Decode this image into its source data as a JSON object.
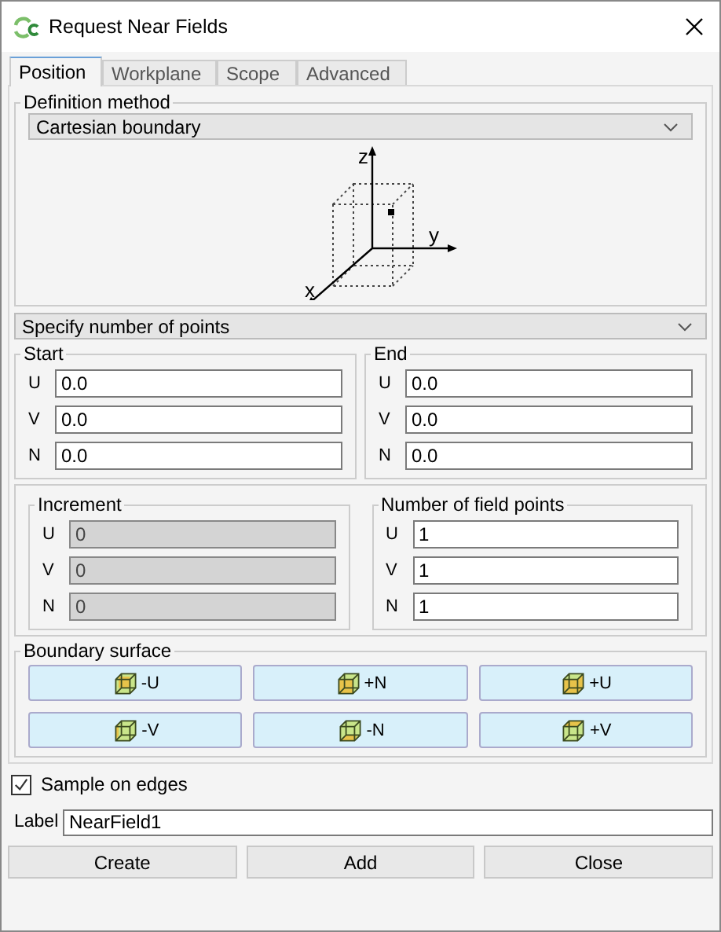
{
  "window": {
    "title": "Request Near Fields"
  },
  "tabs": [
    {
      "label": "Position",
      "selected": true
    },
    {
      "label": "Workplane",
      "selected": false
    },
    {
      "label": "Scope",
      "selected": false
    },
    {
      "label": "Advanced",
      "selected": false
    }
  ],
  "definition_method": {
    "label": "Definition method",
    "value": "Cartesian boundary"
  },
  "diagram_axes": [
    "z",
    "y",
    "x"
  ],
  "points_mode": {
    "value": "Specify number of points"
  },
  "start": {
    "label": "Start",
    "fields": [
      {
        "axis": "U",
        "value": "0.0",
        "disabled": false
      },
      {
        "axis": "V",
        "value": "0.0",
        "disabled": false
      },
      {
        "axis": "N",
        "value": "0.0",
        "disabled": false
      }
    ]
  },
  "end": {
    "label": "End",
    "fields": [
      {
        "axis": "U",
        "value": "0.0",
        "disabled": false
      },
      {
        "axis": "V",
        "value": "0.0",
        "disabled": false
      },
      {
        "axis": "N",
        "value": "0.0",
        "disabled": false
      }
    ]
  },
  "increment": {
    "label": "Increment",
    "fields": [
      {
        "axis": "U",
        "value": "0",
        "disabled": true
      },
      {
        "axis": "V",
        "value": "0",
        "disabled": true
      },
      {
        "axis": "N",
        "value": "0",
        "disabled": true
      }
    ]
  },
  "field_points": {
    "label": "Number of field points",
    "fields": [
      {
        "axis": "U",
        "value": "1",
        "disabled": false
      },
      {
        "axis": "V",
        "value": "1",
        "disabled": false
      },
      {
        "axis": "N",
        "value": "1",
        "disabled": false
      }
    ]
  },
  "boundary_surface": {
    "label": "Boundary surface",
    "buttons": [
      "-U",
      "+N",
      "+U",
      "-V",
      "-N",
      "+V"
    ]
  },
  "sample_on_edges": {
    "label": "Sample on edges",
    "checked": true
  },
  "label_field": {
    "label": "Label",
    "value": "NearField1"
  },
  "buttons": [
    "Create",
    "Add",
    "Close"
  ]
}
